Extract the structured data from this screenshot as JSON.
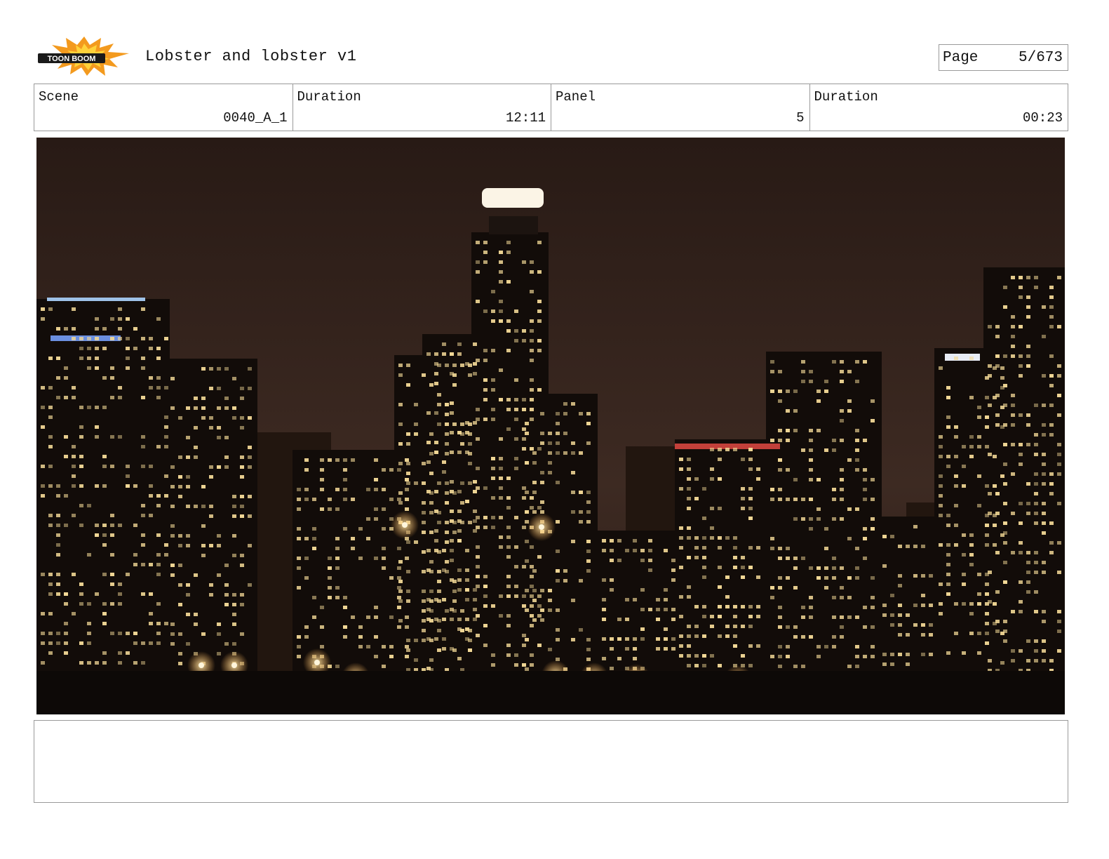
{
  "header": {
    "logo": {
      "icon": "toonboom-logo",
      "text": "TOON BOOM",
      "colors": {
        "burst": "#f39a1e",
        "dark": "#1a1a1a"
      }
    },
    "project_title": "Lobster and lobster v1",
    "page": {
      "label": "Page",
      "value": "5/673"
    }
  },
  "info": [
    {
      "label": "Scene",
      "value": "0040_A_1"
    },
    {
      "label": "Duration",
      "value": "12:11"
    },
    {
      "label": "Panel",
      "value": "5"
    },
    {
      "label": "Duration",
      "value": "00:23"
    }
  ],
  "panel": {
    "image": "night city skyline with lit skyscrapers",
    "colors": {
      "sky": "#3a2820",
      "buildings": "#140d0a",
      "lights": "#f2d896"
    }
  },
  "notes": {
    "text": ""
  }
}
